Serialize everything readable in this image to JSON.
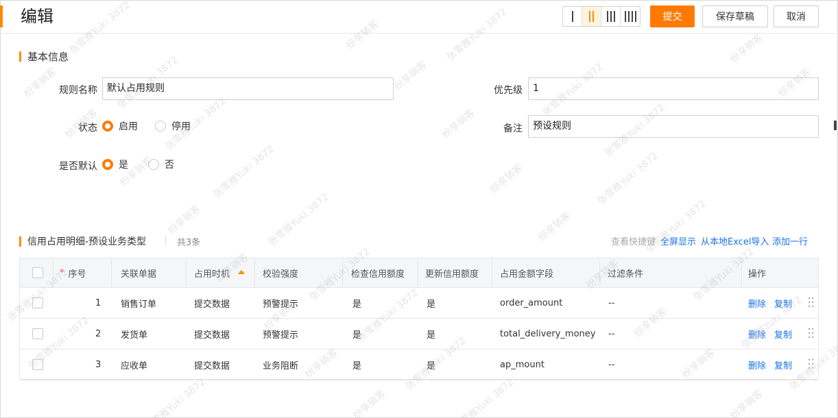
{
  "header": {
    "title": "编辑",
    "layouts": [
      {
        "name": "layout-1-column",
        "bars": 1,
        "active": false
      },
      {
        "name": "layout-2-column",
        "bars": 2,
        "active": true
      },
      {
        "name": "layout-3-column",
        "bars": 3,
        "active": false
      },
      {
        "name": "layout-4-column",
        "bars": 4,
        "active": false
      }
    ],
    "submit_label": "提交",
    "save_draft_label": "保存草稿",
    "cancel_label": "取消",
    "accent_color": "#ff7a00"
  },
  "basic_info": {
    "section_title": "基本信息",
    "rule_name_label": "规则名称",
    "rule_name_value": "默认占用规则",
    "priority_label": "优先级",
    "priority_value": "1",
    "status_label": "状态",
    "status_options": [
      {
        "label": "启用",
        "selected": true
      },
      {
        "label": "停用",
        "selected": false
      }
    ],
    "remark_label": "备注",
    "remark_value": "预设规则",
    "default_label": "是否默认",
    "default_options": [
      {
        "label": "是",
        "selected": true
      },
      {
        "label": "否",
        "selected": false
      }
    ]
  },
  "detail": {
    "section_title": "信用占用明细-预设业务类型",
    "count_text": "共3条",
    "toolbar": {
      "shortcut_label": "查看快捷键",
      "fullscreen_label": "全屏显示",
      "import_label": "从本地Excel导入",
      "add_row_label": "添加一行"
    },
    "columns": [
      "序号",
      "关联单据",
      "占用时机",
      "校验强度",
      "检查信用额度",
      "更新信用额度",
      "占用金额字段",
      "过滤条件",
      "操作"
    ],
    "rows": [
      {
        "seq": "1",
        "doc": "销售订单",
        "timing": "提交数据",
        "strength": "预警提示",
        "check": "是",
        "update": "是",
        "field": "order_amount",
        "filter": "--"
      },
      {
        "seq": "2",
        "doc": "发货单",
        "timing": "提交数据",
        "strength": "预警提示",
        "check": "是",
        "update": "是",
        "field": "total_delivery_money",
        "filter": "--"
      },
      {
        "seq": "3",
        "doc": "应收单",
        "timing": "提交数据",
        "strength": "业务阻断",
        "check": "是",
        "update": "是",
        "field": "ap_mount",
        "filter": "--"
      }
    ],
    "ops": {
      "delete_label": "删除",
      "copy_label": "复制"
    }
  },
  "watermark": {
    "text_a": "张雪雅Yuki 3872",
    "text_b": "纷享销客"
  }
}
